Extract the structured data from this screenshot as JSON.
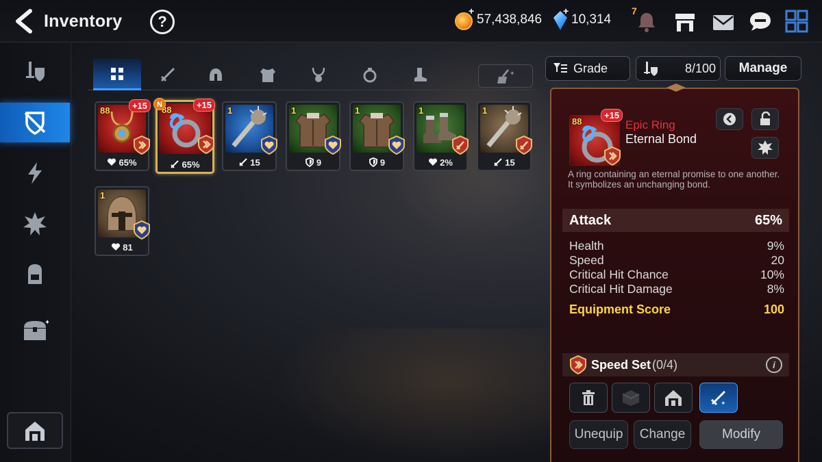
{
  "header": {
    "title": "Inventory",
    "help_symbol": "?",
    "gold": "57,438,846",
    "crystals": "10,314",
    "notif_count": "7"
  },
  "tabs": [
    {
      "name": "all",
      "icon": "grid-icon"
    },
    {
      "name": "weapon",
      "icon": "sword-icon"
    },
    {
      "name": "helmet",
      "icon": "helmet-icon"
    },
    {
      "name": "armor",
      "icon": "armor-icon"
    },
    {
      "name": "necklace",
      "icon": "necklace-icon"
    },
    {
      "name": "ring",
      "icon": "ring-icon"
    },
    {
      "name": "boots",
      "icon": "boots-icon"
    }
  ],
  "items": [
    {
      "bg": "red",
      "level": "88",
      "enhance": "+15",
      "stat": "65%",
      "stat_icon": "heart",
      "set": "speed",
      "kind": "necklace"
    },
    {
      "bg": "red",
      "level": "88",
      "enhance": "+15",
      "new": "N",
      "stat": "65%",
      "stat_icon": "attack",
      "set": "speed",
      "kind": "ring",
      "selected": true
    },
    {
      "bg": "blue",
      "level": "1",
      "stat": "15",
      "stat_icon": "attack",
      "set": "health",
      "kind": "club"
    },
    {
      "bg": "green",
      "level": "1",
      "stat": "9",
      "stat_icon": "defense",
      "set": "health",
      "kind": "armor"
    },
    {
      "bg": "green",
      "level": "1",
      "stat": "9",
      "stat_icon": "defense",
      "set": "health",
      "kind": "armor"
    },
    {
      "bg": "green",
      "level": "1",
      "stat": "2%",
      "stat_icon": "heart",
      "set": "attack",
      "kind": "boots"
    },
    {
      "bg": "brown",
      "level": "1",
      "stat": "15",
      "stat_icon": "attack",
      "set": "attack",
      "kind": "club"
    },
    {
      "bg": "brown",
      "level": "1",
      "stat": "81",
      "stat_icon": "heart",
      "set": "health",
      "kind": "helmet"
    }
  ],
  "sort": {
    "label": "Grade",
    "capacity": "8/100",
    "manage": "Manage"
  },
  "detail": {
    "enhance": "+15",
    "level": "88",
    "grade": "Epic Ring",
    "name": "Eternal Bond",
    "description": "A ring containing an eternal promise to one another. It symbolizes an unchanging bond.",
    "main_stat": {
      "label": "Attack",
      "value": "65%"
    },
    "substats": [
      {
        "label": "Health",
        "value": "9%"
      },
      {
        "label": "Speed",
        "value": "20"
      },
      {
        "label": "Critical Hit Chance",
        "value": "10%"
      },
      {
        "label": "Critical Hit Damage",
        "value": "8%"
      }
    ],
    "score": {
      "label": "Equipment Score",
      "value": "100"
    },
    "set": {
      "name": "Speed Set",
      "count": "(0/4)"
    },
    "info_symbol": "i",
    "buttons": {
      "unequip": "Unequip",
      "change": "Change",
      "modify": "Modify"
    }
  },
  "colors": {
    "accent_blue": "#1f87e8",
    "epic_red": "#e0343a",
    "score_gold": "#ffd44a"
  }
}
